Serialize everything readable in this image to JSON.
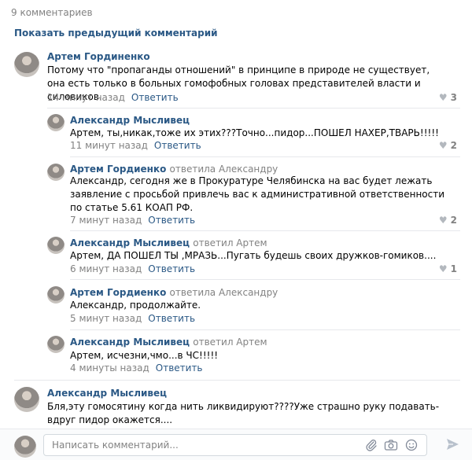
{
  "comments_count": "9 комментариев",
  "show_previous": "Показать предыдущий комментарий",
  "reply_label": "Ответить",
  "comments": [
    {
      "author": "Артем Гординенко",
      "reply_to": "",
      "text": "Потому что \"пропаганды отношений\" в принципе в природе не существует, она есть только в больных гомофобных головах представителей власти и силовиков.",
      "time": "14 минут назад",
      "likes": "3"
    },
    {
      "author": "Александр Мысливец",
      "reply_to": "",
      "text": "Артем, ты,никак,тоже их этих???Точно...пидор...ПОШЕЛ НАХЕР,ТВАРЬ!!!!!",
      "time": "11 минут назад",
      "likes": "2"
    },
    {
      "author": "Артем Гордиенко",
      "reply_to": "ответила Александру",
      "text": "Александр, сегодня же в Прокуратуре Челябинска на вас будет лежать заявление с просьбой привлечь вас к административной ответственности по статье 5.61 КОАП РФ.",
      "time": "7 минут назад",
      "likes": "2"
    },
    {
      "author": "Александр Мысливец",
      "reply_to": "ответил Артем",
      "text": "Артем, ДА ПОШЕЛ ТЫ ,МРАЗЬ...Пугать будешь своих дружков-гомиков....",
      "time": "6 минут назад",
      "likes": "1"
    },
    {
      "author": "Артем Гордиенко",
      "reply_to": "ответила Александру",
      "text": "Александр, продолжайте.",
      "time": "5 минут назад",
      "likes": ""
    },
    {
      "author": "Александр Мысливец",
      "reply_to": "ответил Артем",
      "text": "Артем, исчезни,чмо...в ЧС!!!!!",
      "time": "4 минуты назад",
      "likes": ""
    },
    {
      "author": "Александр Мысливец",
      "reply_to": "",
      "text": "Бля,эту гомосятину когда нить ликвидируют????Уже страшно руку подавать-вдруг пидор окажется....",
      "time": "",
      "likes": ""
    }
  ],
  "composer": {
    "placeholder": "Написать комментарий..."
  },
  "icons": {
    "attach": "paperclip-icon",
    "camera": "camera-icon",
    "emoji": "smile-icon",
    "send": "send-icon",
    "like": "heart-icon"
  },
  "colors": {
    "link": "#2a5885",
    "muted": "#828282",
    "heart": "#b3b8be"
  }
}
